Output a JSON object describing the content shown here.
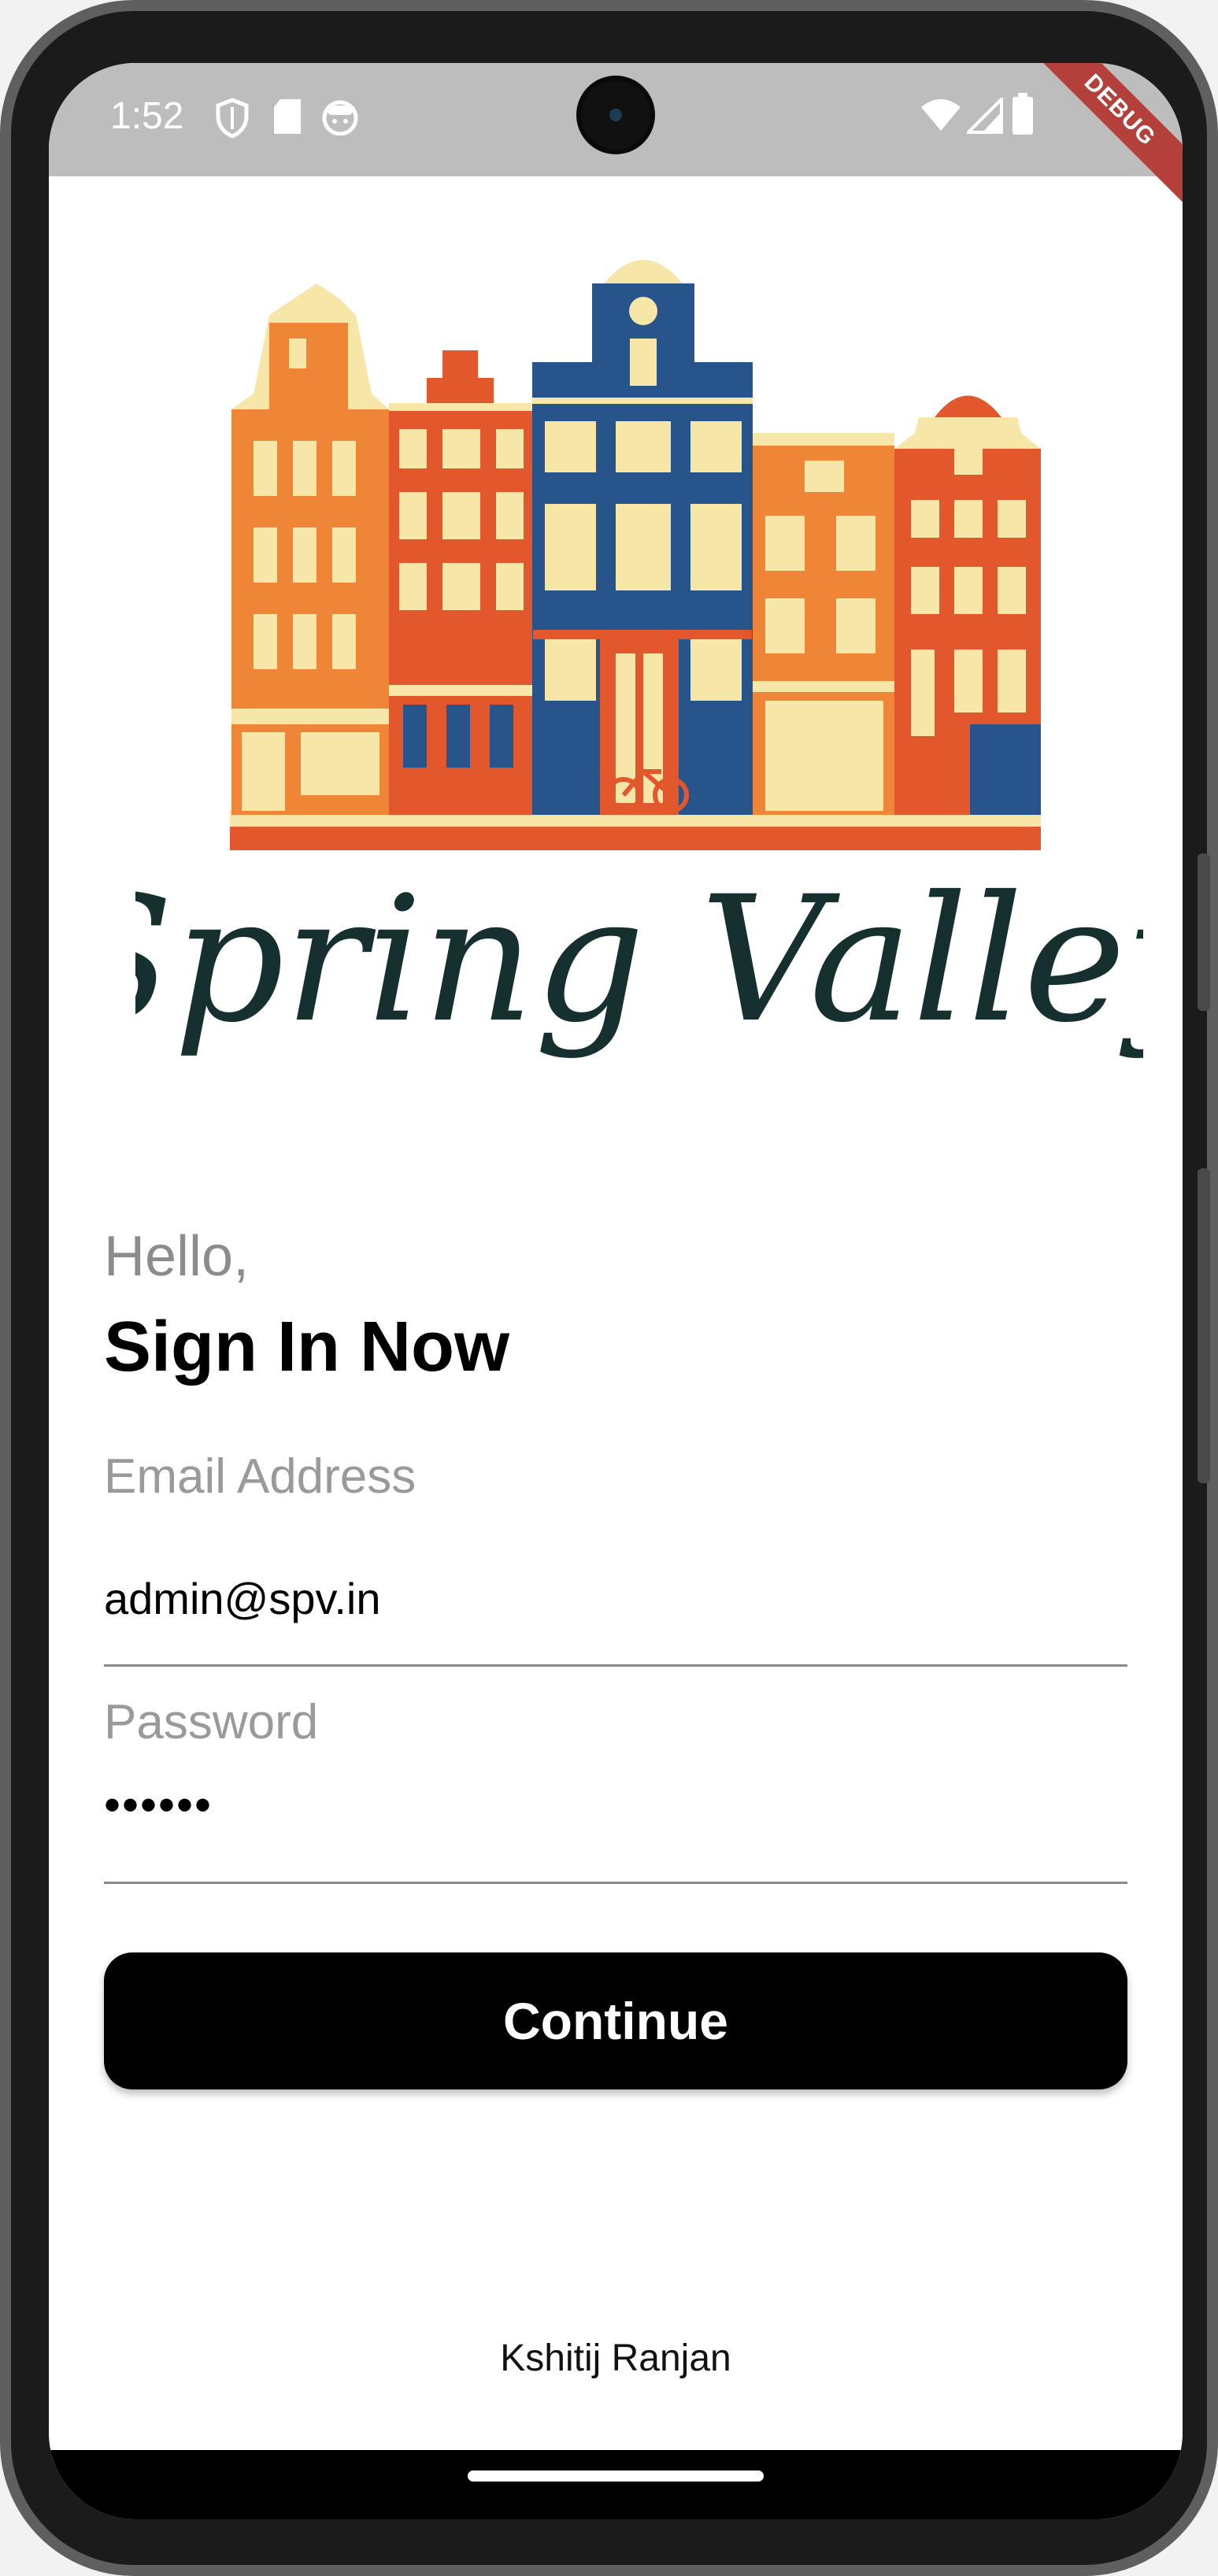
{
  "status_bar": {
    "time": "1:52",
    "icons": [
      "shield-icon",
      "sd-card-icon",
      "face-icon",
      "wifi-icon",
      "cellular-icon",
      "battery-icon"
    ],
    "debug_banner": "DEBUG"
  },
  "brand": {
    "name": "Spring Valley",
    "illustration": "townhouses-illustration",
    "colors": {
      "orange": "#EE8537",
      "red_orange": "#E2572B",
      "navy": "#27548A",
      "cream": "#F6E6A8"
    }
  },
  "login": {
    "greeting": "Hello,",
    "title": "Sign In Now",
    "email_label": "Email Address",
    "email_value": "admin@spv.in",
    "password_label": "Password",
    "password_value": "••••••",
    "continue_label": "Continue"
  },
  "footer": {
    "author": "Kshitij Ranjan"
  }
}
